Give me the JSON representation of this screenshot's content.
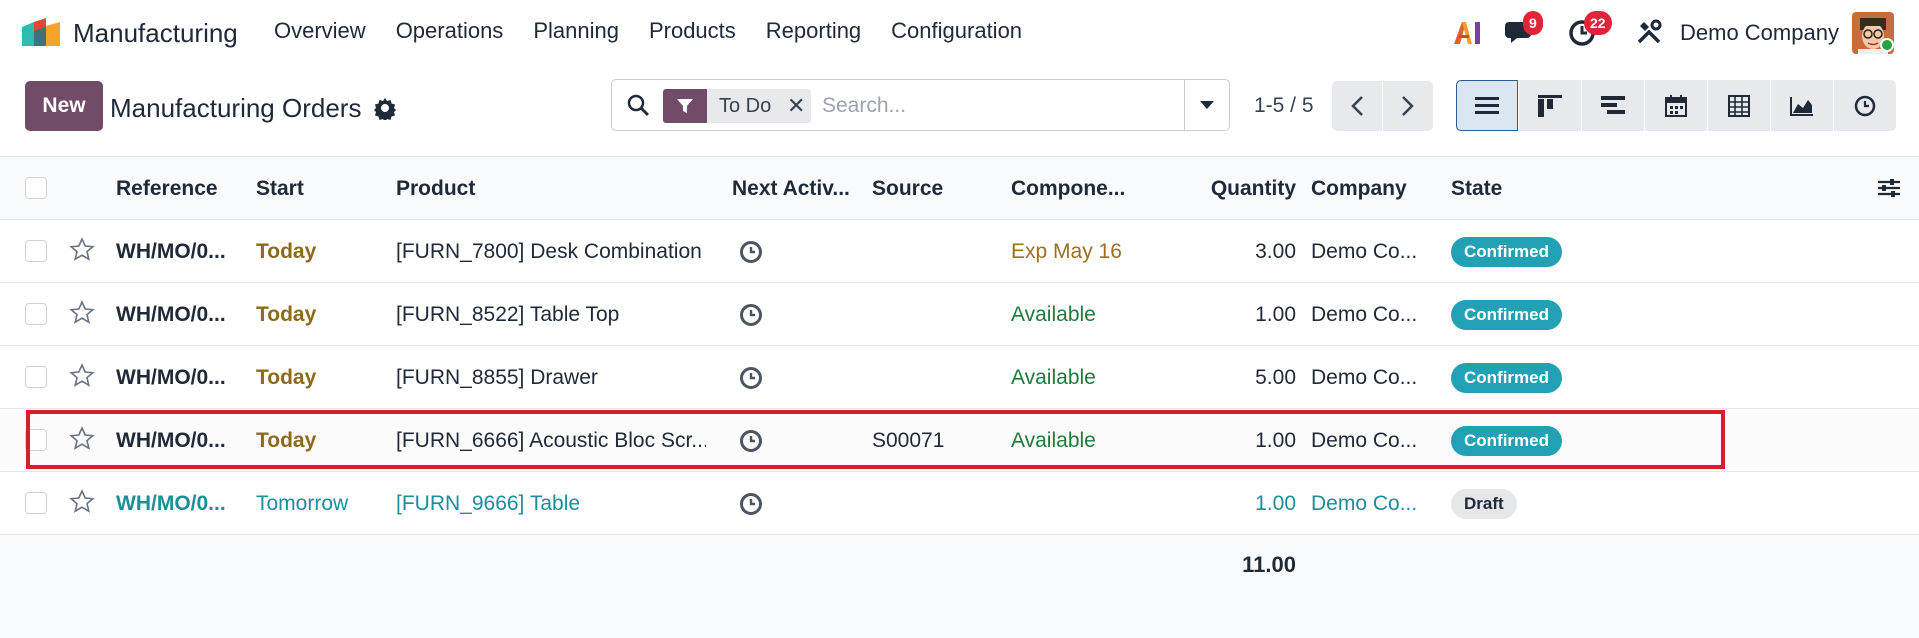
{
  "nav": {
    "app_name": "Manufacturing",
    "menu": [
      "Overview",
      "Operations",
      "Planning",
      "Products",
      "Reporting",
      "Configuration"
    ],
    "messages_count": "9",
    "activities_count": "22",
    "company": "Demo Company",
    "brand_color": "#714b67"
  },
  "control": {
    "new_label": "New",
    "title": "Manufacturing Orders",
    "facet_label": "To Do",
    "search_placeholder": "Search...",
    "pager": "1-5 / 5"
  },
  "list": {
    "columns": [
      "Reference",
      "Start",
      "Product",
      "Next Activ...",
      "Source",
      "Compone...",
      "Quantity",
      "Company",
      "State"
    ],
    "rows": [
      {
        "reference": "WH/MO/0...",
        "start": "Today",
        "product": "[FURN_7800] Desk Combination",
        "source": "",
        "components": "Exp May 16",
        "quantity": "3.00",
        "company": "Demo Co...",
        "state": "Confirmed"
      },
      {
        "reference": "WH/MO/0...",
        "start": "Today",
        "product": "[FURN_8522] Table Top",
        "source": "",
        "components": "Available",
        "quantity": "1.00",
        "company": "Demo Co...",
        "state": "Confirmed"
      },
      {
        "reference": "WH/MO/0...",
        "start": "Today",
        "product": "[FURN_8855] Drawer",
        "source": "",
        "components": "Available",
        "quantity": "5.00",
        "company": "Demo Co...",
        "state": "Confirmed"
      },
      {
        "reference": "WH/MO/0...",
        "start": "Today",
        "product": "[FURN_6666] Acoustic Bloc Scr...",
        "source": "S00071",
        "components": "Available",
        "quantity": "1.00",
        "company": "Demo Co...",
        "state": "Confirmed"
      },
      {
        "reference": "WH/MO/0...",
        "start": "Tomorrow",
        "product": "[FURN_9666] Table",
        "source": "",
        "components": "",
        "quantity": "1.00",
        "company": "Demo Co...",
        "state": "Draft"
      }
    ],
    "total_quantity": "11.00"
  },
  "colors": {
    "confirmed": "#22a1b5",
    "highlight": "#d3202b",
    "today": "#8d6a1a",
    "available": "#1f7a3d",
    "draft_row": "#1b8e9a"
  },
  "icons": [
    "ai-icon",
    "chat-icon",
    "activity-icon",
    "tools-icon",
    "gear-icon",
    "search-icon",
    "filter-icon",
    "close-icon",
    "chevron-down-icon",
    "chevron-left-icon",
    "chevron-right-icon",
    "list-view-icon",
    "kanban-view-icon",
    "gantt-view-icon",
    "calendar-view-icon",
    "pivot-view-icon",
    "graph-view-icon",
    "activity-view-icon",
    "star-icon",
    "optional-columns-icon"
  ]
}
